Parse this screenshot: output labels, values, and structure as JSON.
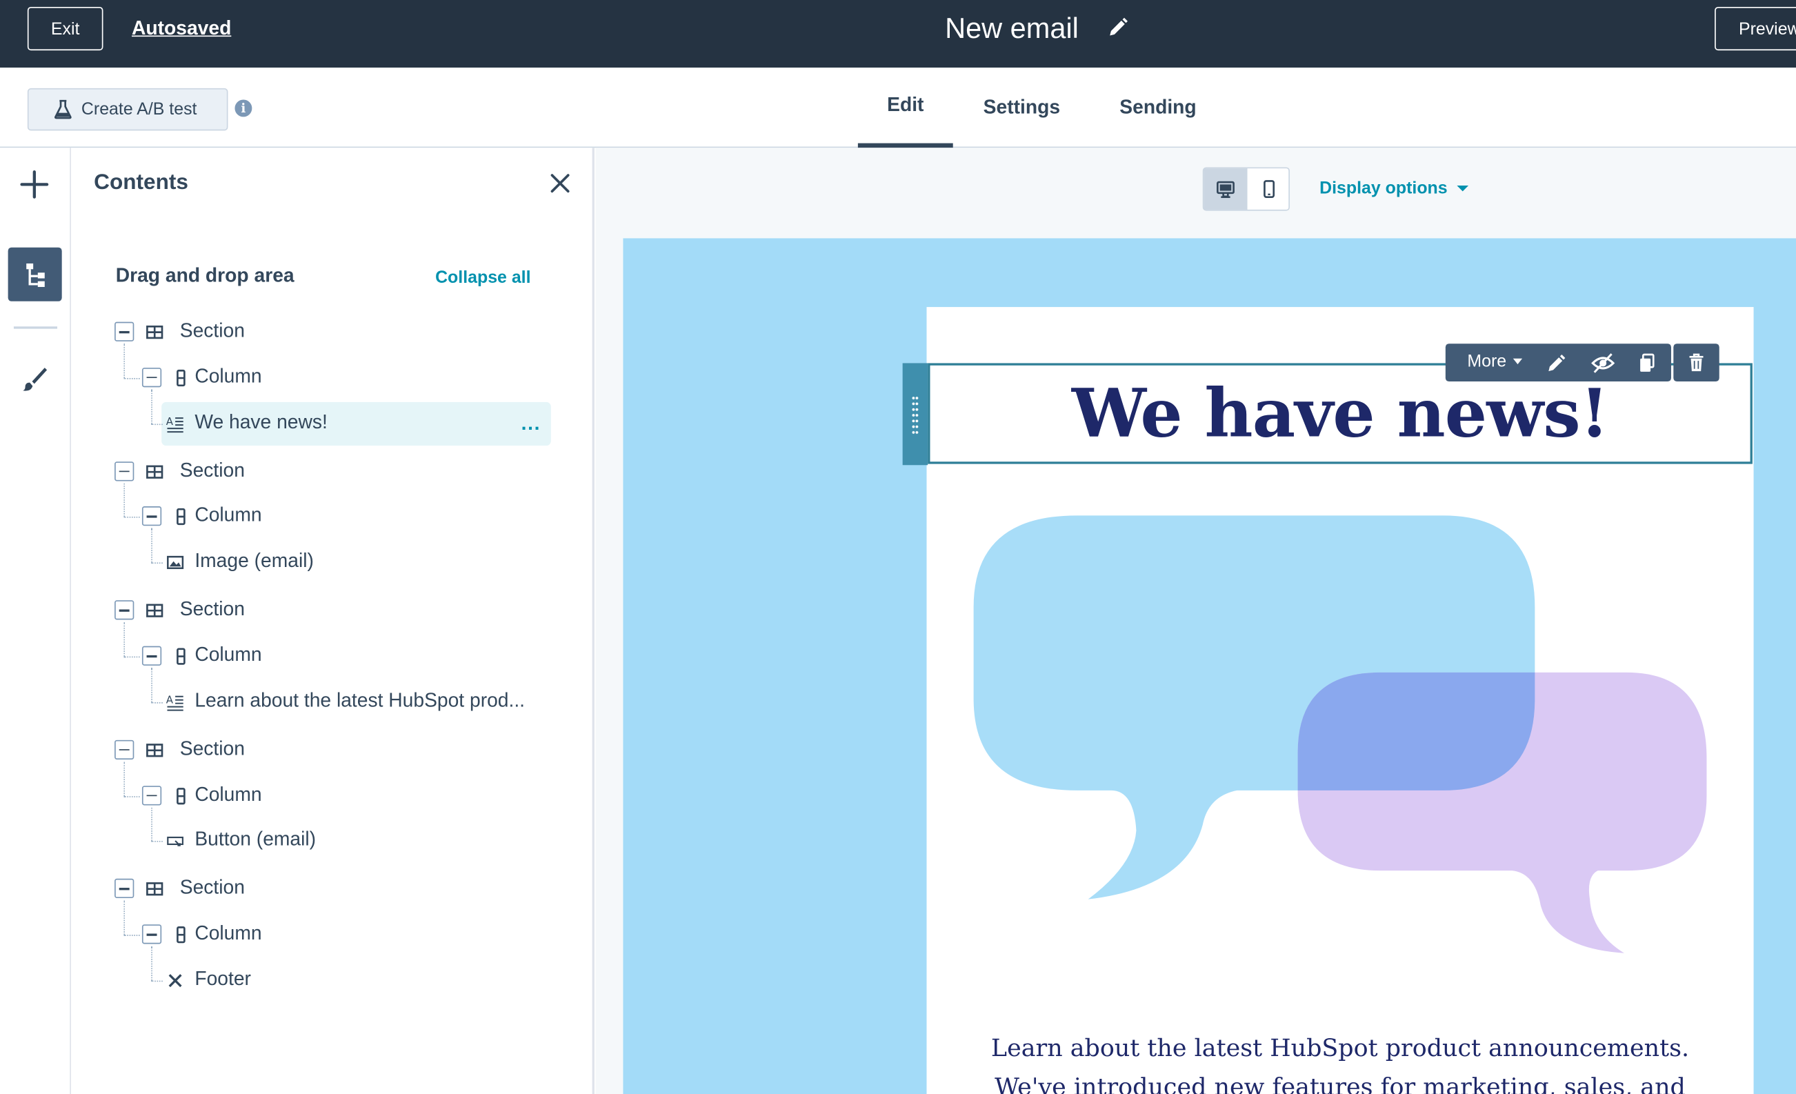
{
  "topbar": {
    "exit_label": "Exit",
    "autosaved_label": "Autosaved",
    "email_title": "New email",
    "preview_label": "Preview"
  },
  "subbar": {
    "ab_test_label": "Create A/B test",
    "tabs": [
      {
        "label": "Edit",
        "active": true
      },
      {
        "label": "Settings",
        "active": false
      },
      {
        "label": "Sending",
        "active": false
      }
    ]
  },
  "panel": {
    "title": "Contents",
    "area_label": "Drag and drop area",
    "collapse_all_label": "Collapse all",
    "tree": [
      {
        "section": "Section",
        "column": "Column",
        "module": "We have news!",
        "module_icon": "rich-text-icon",
        "selected": true
      },
      {
        "section": "Section",
        "column": "Column",
        "module": "Image (email)",
        "module_icon": "image-icon",
        "selected": false
      },
      {
        "section": "Section",
        "column": "Column",
        "module": "Learn about the latest HubSpot prod...",
        "module_icon": "rich-text-icon",
        "selected": false
      },
      {
        "section": "Section",
        "column": "Column",
        "module": "Button (email)",
        "module_icon": "button-icon",
        "selected": false
      },
      {
        "section": "Section",
        "column": "Column",
        "module": "Footer",
        "module_icon": "footer-icon",
        "selected": false
      }
    ],
    "row_more_label": "..."
  },
  "canvas": {
    "display_options_label": "Display options",
    "toolbar_more_label": "More",
    "heading_text": "We have news!",
    "paragraph_text": "Learn about the latest HubSpot product announcements. We've introduced new features for marketing, sales, and customer service to"
  },
  "colors": {
    "topbar_bg": "#253342",
    "accent": "#0091ae",
    "email_background": "#a3dbf8",
    "heading_color": "#1e2869",
    "bubble_blue": "#a3dbf8",
    "bubble_purple": "#d8c6f3"
  }
}
